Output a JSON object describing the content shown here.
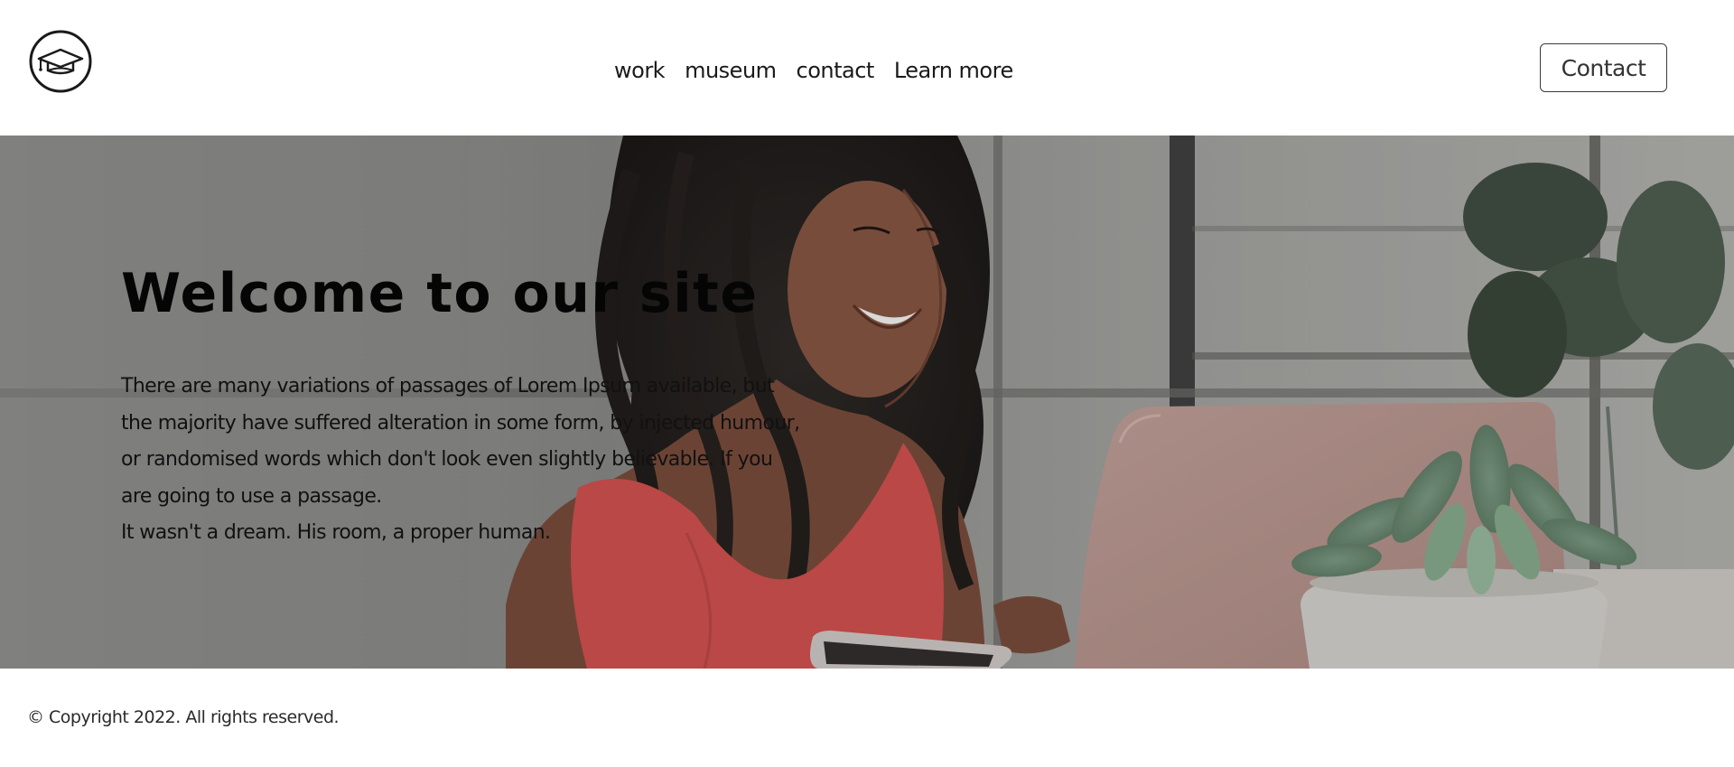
{
  "header": {
    "logo_icon": "graduation-cap-icon",
    "nav": {
      "items": [
        {
          "label": "work"
        },
        {
          "label": "museum"
        },
        {
          "label": "contact"
        },
        {
          "label": "Learn more"
        }
      ]
    },
    "contact_button_label": "Contact"
  },
  "hero": {
    "title": "Welcome to our site",
    "paragraph": "There are many variations of passages of Lorem Ipsum available, but the majority have suffered alteration in some form, by injected humour, or randomised words which don't look even slightly believable. If you are going to use a passage.",
    "subline": "It wasn't a dream. His room, a proper human."
  },
  "footer": {
    "copyright": "© Copyright 2022. All rights reserved."
  },
  "colors": {
    "background": "#ffffff",
    "text": "#1a1a1a",
    "dress_accent": "#d9504e"
  }
}
